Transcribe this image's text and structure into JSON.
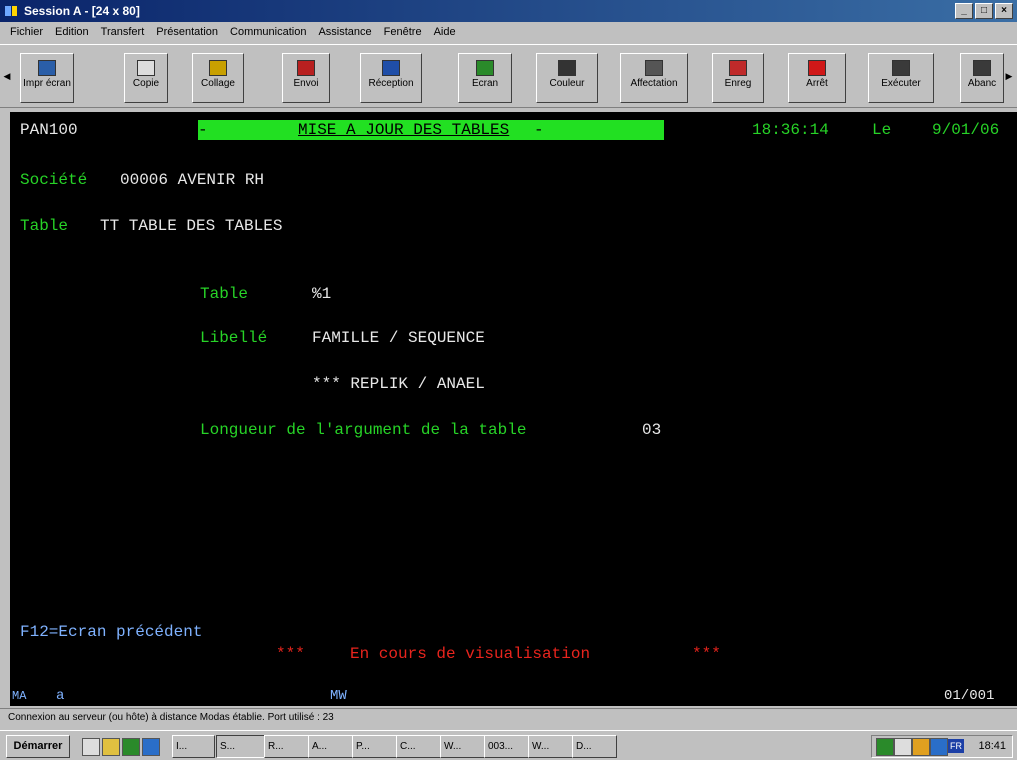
{
  "window": {
    "title": "Session A - [24 x 80]",
    "min": "_",
    "max": "□",
    "close": "×"
  },
  "menu": [
    "Fichier",
    "Edition",
    "Transfert",
    "Présentation",
    "Communication",
    "Assistance",
    "Fenêtre",
    "Aide"
  ],
  "toolbar": [
    {
      "label": "Impr écran",
      "icon": "print-screen-icon",
      "color": "#2a5ea8"
    },
    {
      "label": "Copie",
      "icon": "copy-icon",
      "color": "#cccccc"
    },
    {
      "label": "Collage",
      "icon": "paste-icon",
      "color": "#c8a000"
    },
    {
      "label": "Envoi",
      "icon": "send-icon",
      "color": "#b82020"
    },
    {
      "label": "Réception",
      "icon": "receive-icon",
      "color": "#1f4ea8"
    },
    {
      "label": "Ecran",
      "icon": "screen-icon",
      "color": "#2a8a2a"
    },
    {
      "label": "Couleur",
      "icon": "color-icon",
      "color": "#333333"
    },
    {
      "label": "Affectation",
      "icon": "keyboard-map-icon",
      "color": "#555555"
    },
    {
      "label": "Enreg",
      "icon": "record-icon",
      "color": "#c02a2a"
    },
    {
      "label": "Arrêt",
      "icon": "stop-icon",
      "color": "#d01818"
    },
    {
      "label": "Exécuter",
      "icon": "play-macro-icon",
      "color": "#3a3a3a"
    },
    {
      "label": "Abanc",
      "icon": "abandon-icon",
      "color": "#3a3a3a"
    }
  ],
  "screen": {
    "program": "PAN100",
    "title": "MISE A JOUR DES TABLES",
    "title_bar": "-                                  -",
    "time": "18:36:14",
    "date_label": "Le",
    "date": "9/01/06",
    "company_label": "Société",
    "company_value": "00006 AVENIR RH",
    "table_label": "Table",
    "table_value": "TT TABLE DES TABLES",
    "field_table_label": "Table",
    "field_table_value": "%1",
    "field_libelle_label": "Libellé",
    "field_libelle_value": "FAMILLE / SEQUENCE",
    "field_libelle_value2": "*** REPLIK / ANAEL",
    "field_length_label": "Longueur de l'argument de la table",
    "field_length_value": "03",
    "fkey": "F12=Ecran précédent",
    "msg_stars_left": "***",
    "msg": "En cours de visualisation",
    "msg_stars_right": "***"
  },
  "oia": {
    "left": "MA",
    "mid": "a",
    "mode": "MW",
    "position": "01/001"
  },
  "statusbar": "Connexion au serveur (ou hôte) à distance Modas établie. Port utilisé : 23",
  "taskbar": {
    "start": "Démarrer",
    "tasks": [
      "I...",
      "S...",
      "R...",
      "A...",
      "P...",
      "C...",
      "W...",
      "003...",
      "W...",
      "D..."
    ],
    "lang": "FR",
    "clock": "18:41"
  }
}
